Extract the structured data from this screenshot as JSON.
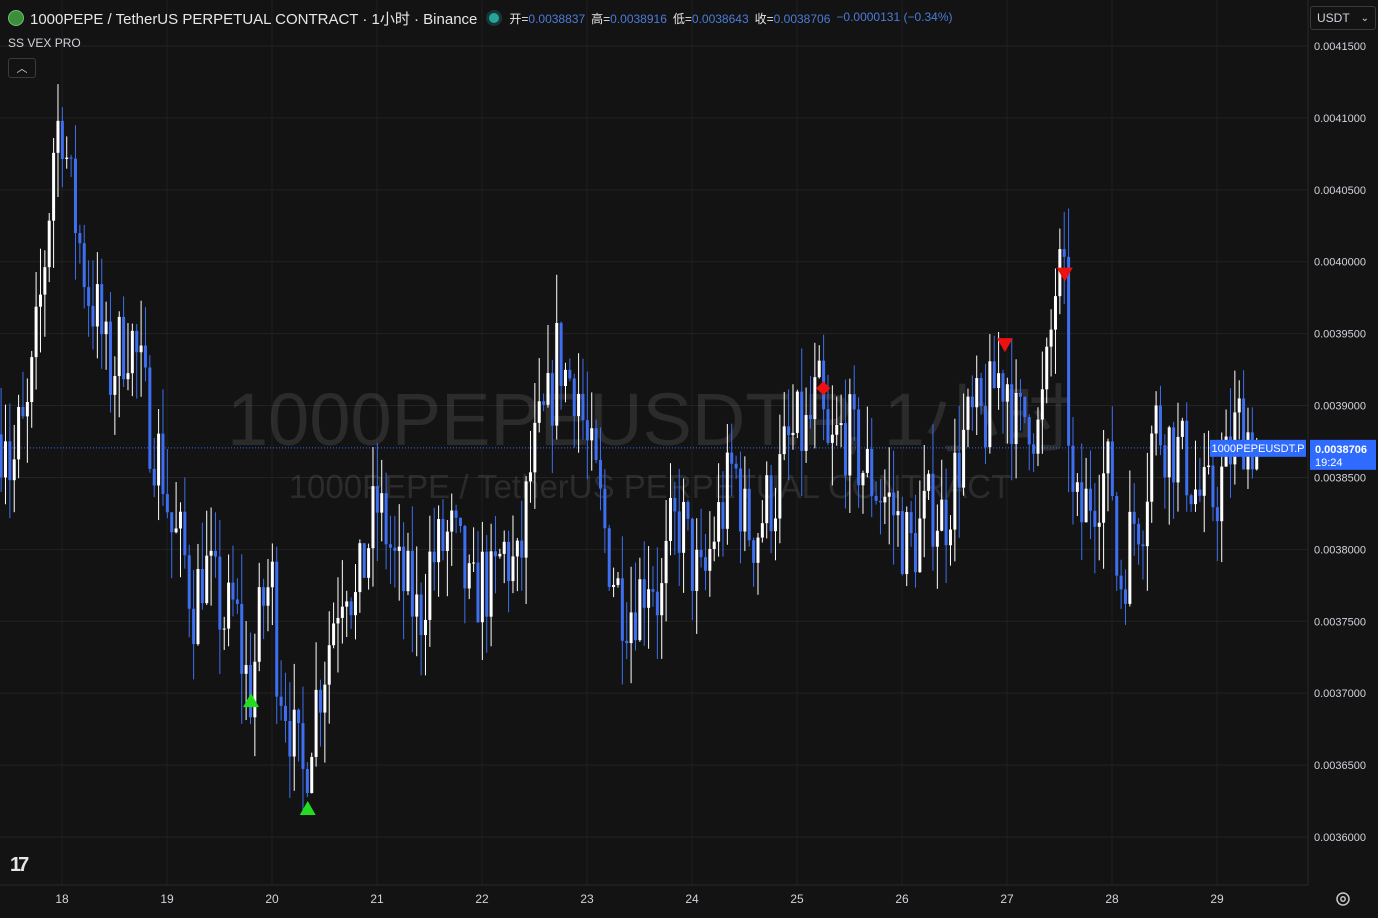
{
  "header": {
    "title": "1000PEPE / TetherUS PERPETUAL CONTRACT · 1小时 · Binance",
    "open_label": "开=",
    "open": "0.0038837",
    "high_label": "高=",
    "high": "0.0038916",
    "low_label": "低=",
    "low": "0.0038643",
    "close_label": "收=",
    "close": "0.0038706",
    "change": "−0.0000131 (−0.34%)"
  },
  "indicator_name": "SS VEX PRO",
  "currency_selector": "USDT",
  "watermark": {
    "line1": "1000PEPEUSDT.P, 1小时",
    "line2": "1000PEPE / TetherUS PERPETUAL CONTRACT"
  },
  "last_price": {
    "symbol_label": "1000PEPEUSDT.P",
    "price": "0.0038706",
    "countdown": "19:24"
  },
  "colors": {
    "background": "#131313",
    "up_candle": "#ffffff",
    "down_candle": "#3d6ff0",
    "buy_signal": "#22dd22",
    "sell_signal": "#ee1111",
    "price_tag": "#2f6bff"
  },
  "chart_data": {
    "type": "candlestick",
    "timeframe": "1小时",
    "ylim": [
      0.00359,
      0.00417
    ],
    "y_ticks": [
      "0.0036000",
      "0.0036500",
      "0.0037000",
      "0.0037500",
      "0.0038000",
      "0.0038500",
      "0.0039000",
      "0.0039500",
      "0.0040000",
      "0.0040500",
      "0.0041000",
      "0.0041500"
    ],
    "x_ticks": [
      "18",
      "19",
      "20",
      "21",
      "22",
      "23",
      "24",
      "25",
      "26",
      "27",
      "28",
      "29"
    ],
    "close_path": [
      {
        "day": 17.42,
        "price": 0.00388
      },
      {
        "day": 17.47,
        "price": 0.003895
      },
      {
        "day": 17.52,
        "price": 0.00384
      },
      {
        "day": 17.57,
        "price": 0.00388
      },
      {
        "day": 17.65,
        "price": 0.00388
      },
      {
        "day": 17.72,
        "price": 0.00392
      },
      {
        "day": 17.82,
        "price": 0.00399
      },
      {
        "day": 17.88,
        "price": 0.00404
      },
      {
        "day": 17.93,
        "price": 0.00409
      },
      {
        "day": 18.0,
        "price": 0.0041
      },
      {
        "day": 18.08,
        "price": 0.00405
      },
      {
        "day": 18.15,
        "price": 0.00402
      },
      {
        "day": 18.25,
        "price": 0.00398
      },
      {
        "day": 18.35,
        "price": 0.00396
      },
      {
        "day": 18.45,
        "price": 0.00392
      },
      {
        "day": 18.55,
        "price": 0.00394
      },
      {
        "day": 18.65,
        "price": 0.00395
      },
      {
        "day": 18.75,
        "price": 0.00392
      },
      {
        "day": 18.85,
        "price": 0.00388
      },
      {
        "day": 18.95,
        "price": 0.00386
      },
      {
        "day": 19.05,
        "price": 0.00381
      },
      {
        "day": 19.15,
        "price": 0.0038
      },
      {
        "day": 19.25,
        "price": 0.00376
      },
      {
        "day": 19.35,
        "price": 0.00379
      },
      {
        "day": 19.45,
        "price": 0.00377
      },
      {
        "day": 19.55,
        "price": 0.00375
      },
      {
        "day": 19.65,
        "price": 0.00376
      },
      {
        "day": 19.72,
        "price": 0.00372
      },
      {
        "day": 19.8,
        "price": 0.0037
      },
      {
        "day": 19.9,
        "price": 0.00376
      },
      {
        "day": 20.0,
        "price": 0.00378
      },
      {
        "day": 20.05,
        "price": 0.00372
      },
      {
        "day": 20.15,
        "price": 0.00369
      },
      {
        "day": 20.22,
        "price": 0.00366
      },
      {
        "day": 20.3,
        "price": 0.00364
      },
      {
        "day": 20.4,
        "price": 0.00369
      },
      {
        "day": 20.5,
        "price": 0.00372
      },
      {
        "day": 20.6,
        "price": 0.00376
      },
      {
        "day": 20.7,
        "price": 0.00379
      },
      {
        "day": 20.8,
        "price": 0.00376
      },
      {
        "day": 20.9,
        "price": 0.0038
      },
      {
        "day": 21.0,
        "price": 0.00383
      },
      {
        "day": 21.1,
        "price": 0.00381
      },
      {
        "day": 21.2,
        "price": 0.00378
      },
      {
        "day": 21.3,
        "price": 0.00377
      },
      {
        "day": 21.4,
        "price": 0.00375
      },
      {
        "day": 21.5,
        "price": 0.00379
      },
      {
        "day": 21.6,
        "price": 0.0038
      },
      {
        "day": 21.7,
        "price": 0.00381
      },
      {
        "day": 21.8,
        "price": 0.00379
      },
      {
        "day": 21.9,
        "price": 0.00376
      },
      {
        "day": 22.0,
        "price": 0.00378
      },
      {
        "day": 22.1,
        "price": 0.00377
      },
      {
        "day": 22.2,
        "price": 0.0038
      },
      {
        "day": 22.35,
        "price": 0.00378
      },
      {
        "day": 22.45,
        "price": 0.00385
      },
      {
        "day": 22.55,
        "price": 0.00388
      },
      {
        "day": 22.65,
        "price": 0.0039
      },
      {
        "day": 22.72,
        "price": 0.00394
      },
      {
        "day": 22.8,
        "price": 0.00392
      },
      {
        "day": 22.9,
        "price": 0.00392
      },
      {
        "day": 23.0,
        "price": 0.00387
      },
      {
        "day": 23.1,
        "price": 0.00384
      },
      {
        "day": 23.2,
        "price": 0.0038
      },
      {
        "day": 23.3,
        "price": 0.00377
      },
      {
        "day": 23.4,
        "price": 0.00376
      },
      {
        "day": 23.5,
        "price": 0.00377
      },
      {
        "day": 23.6,
        "price": 0.00379
      },
      {
        "day": 23.7,
        "price": 0.00376
      },
      {
        "day": 23.8,
        "price": 0.00381
      },
      {
        "day": 23.9,
        "price": 0.00382
      },
      {
        "day": 24.0,
        "price": 0.00379
      },
      {
        "day": 24.1,
        "price": 0.00377
      },
      {
        "day": 24.2,
        "price": 0.00381
      },
      {
        "day": 24.3,
        "price": 0.00383
      },
      {
        "day": 24.4,
        "price": 0.00386
      },
      {
        "day": 24.5,
        "price": 0.00382
      },
      {
        "day": 24.6,
        "price": 0.00381
      },
      {
        "day": 24.7,
        "price": 0.00383
      },
      {
        "day": 24.8,
        "price": 0.00384
      },
      {
        "day": 24.9,
        "price": 0.00387
      },
      {
        "day": 25.0,
        "price": 0.00388
      },
      {
        "day": 25.1,
        "price": 0.00388
      },
      {
        "day": 25.2,
        "price": 0.00391
      },
      {
        "day": 25.3,
        "price": 0.00386
      },
      {
        "day": 25.4,
        "price": 0.00388
      },
      {
        "day": 25.5,
        "price": 0.00388
      },
      {
        "day": 25.6,
        "price": 0.00386
      },
      {
        "day": 25.7,
        "price": 0.00385
      },
      {
        "day": 25.8,
        "price": 0.00384
      },
      {
        "day": 25.9,
        "price": 0.00383
      },
      {
        "day": 26.0,
        "price": 0.00381
      },
      {
        "day": 26.1,
        "price": 0.0038
      },
      {
        "day": 26.2,
        "price": 0.00382
      },
      {
        "day": 26.3,
        "price": 0.00383
      },
      {
        "day": 26.4,
        "price": 0.00382
      },
      {
        "day": 26.5,
        "price": 0.00385
      },
      {
        "day": 26.6,
        "price": 0.00388
      },
      {
        "day": 26.7,
        "price": 0.00389
      },
      {
        "day": 26.8,
        "price": 0.00389
      },
      {
        "day": 26.9,
        "price": 0.00392
      },
      {
        "day": 27.0,
        "price": 0.00392
      },
      {
        "day": 27.1,
        "price": 0.00388
      },
      {
        "day": 27.2,
        "price": 0.0039
      },
      {
        "day": 27.3,
        "price": 0.00388
      },
      {
        "day": 27.4,
        "price": 0.00393
      },
      {
        "day": 27.45,
        "price": 0.00398
      },
      {
        "day": 27.52,
        "price": 0.00399
      },
      {
        "day": 27.57,
        "price": 0.00396
      },
      {
        "day": 27.6,
        "price": 0.00383
      },
      {
        "day": 27.7,
        "price": 0.00382
      },
      {
        "day": 27.8,
        "price": 0.00384
      },
      {
        "day": 27.9,
        "price": 0.00385
      },
      {
        "day": 28.0,
        "price": 0.00385
      },
      {
        "day": 28.05,
        "price": 0.00378
      },
      {
        "day": 28.1,
        "price": 0.00378
      },
      {
        "day": 28.2,
        "price": 0.00382
      },
      {
        "day": 28.3,
        "price": 0.00383
      },
      {
        "day": 28.4,
        "price": 0.00389
      },
      {
        "day": 28.5,
        "price": 0.00388
      },
      {
        "day": 28.6,
        "price": 0.00387
      },
      {
        "day": 28.7,
        "price": 0.00386
      },
      {
        "day": 28.8,
        "price": 0.00384
      },
      {
        "day": 28.9,
        "price": 0.00383
      },
      {
        "day": 29.0,
        "price": 0.00384
      },
      {
        "day": 29.1,
        "price": 0.00386
      },
      {
        "day": 29.2,
        "price": 0.00389
      },
      {
        "day": 29.3,
        "price": 0.00388
      },
      {
        "day": 29.4,
        "price": 0.00387
      }
    ],
    "signals": [
      {
        "type": "buy",
        "day": 19.8,
        "price": 0.0037
      },
      {
        "type": "buy",
        "day": 20.34,
        "price": 0.003625
      },
      {
        "type": "diamond",
        "day": 25.25,
        "price": 0.003912
      },
      {
        "type": "sell",
        "day": 26.98,
        "price": 0.003942
      },
      {
        "type": "sell",
        "day": 27.55,
        "price": 0.003991
      }
    ]
  }
}
